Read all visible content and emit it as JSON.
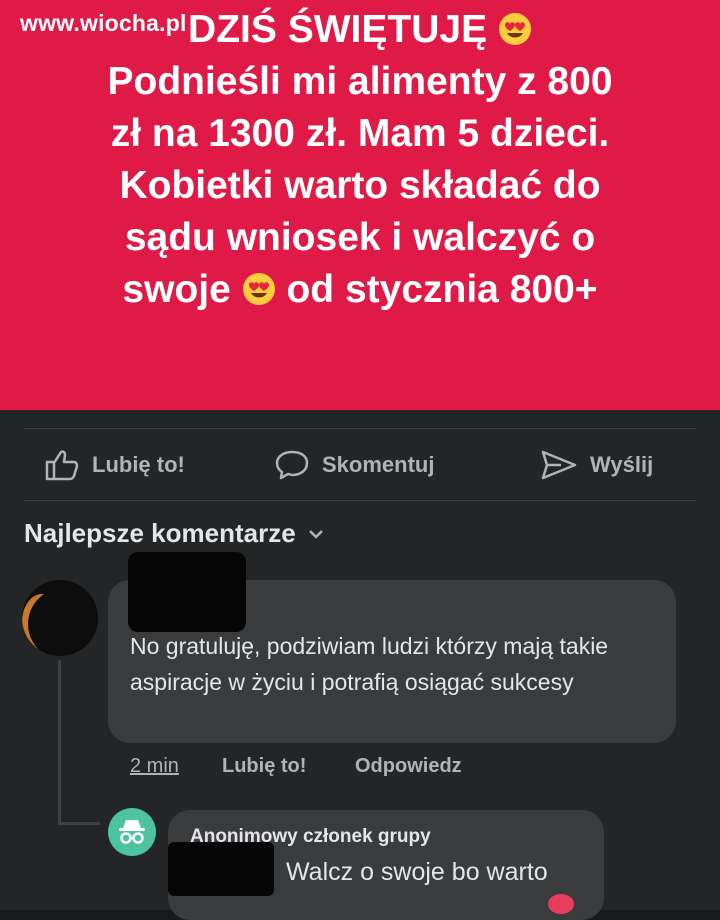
{
  "watermark": "www.wiocha.pl",
  "post": {
    "line1": "DZIŚ ŚWIĘTUJĘ",
    "line2": "Podnieśli mi alimenty z 800",
    "line3": "zł na 1300 zł. Mam 5 dzieci.",
    "line4": "Kobietki warto składać do",
    "line5": "sądu wniosek i walczyć o",
    "line6a": "swoje",
    "line6b": "od stycznia 800+",
    "background_color": "#df1a46",
    "emoji": "heart-eyes-emoji"
  },
  "actions": {
    "like": "Lubię to!",
    "comment": "Skomentuj",
    "send": "Wyślij"
  },
  "comments_header": "Najlepsze komentarze",
  "comment1": {
    "text": "No gratuluję, podziwiam ludzi którzy mają takie aspiracje w życiu i potrafią osiągać sukcesy",
    "time": "2 min",
    "like": "Lubię to!",
    "reply": "Odpowiedz"
  },
  "reply1": {
    "author": "Anonimowy członek grupy",
    "text": "Walcz o swoje bo warto"
  }
}
